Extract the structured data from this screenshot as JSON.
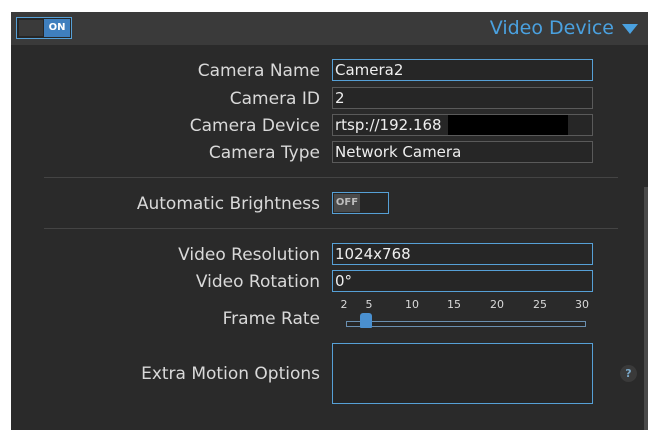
{
  "header": {
    "toggle_label": "ON",
    "title": "Video Device",
    "caret_icon": "caret-down-icon"
  },
  "fields": {
    "camera_name_label": "Camera Name",
    "camera_name_value": "Camera2",
    "camera_id_label": "Camera ID",
    "camera_id_value": "2",
    "camera_device_label": "Camera Device",
    "camera_device_value": "rtsp://192.168",
    "camera_type_label": "Camera Type",
    "camera_type_value": "Network Camera",
    "auto_brightness_label": "Automatic Brightness",
    "auto_brightness_toggle": "OFF",
    "video_resolution_label": "Video Resolution",
    "video_resolution_value": "1024x768",
    "video_rotation_label": "Video Rotation",
    "video_rotation_value": "0°",
    "frame_rate_label": "Frame Rate",
    "frame_rate_ticks": [
      "2",
      "5",
      "10",
      "15",
      "20",
      "25",
      "30"
    ],
    "frame_rate_min": 2,
    "frame_rate_max": 30,
    "frame_rate_value": 5,
    "extra_motion_label": "Extra Motion Options",
    "extra_motion_value": "",
    "help_symbol": "?"
  },
  "colors": {
    "accent": "#4aa1e0",
    "panel_bg": "#2a2a2a",
    "header_bg": "#3a3a3a",
    "toggle_on": "#3f7fbe"
  }
}
